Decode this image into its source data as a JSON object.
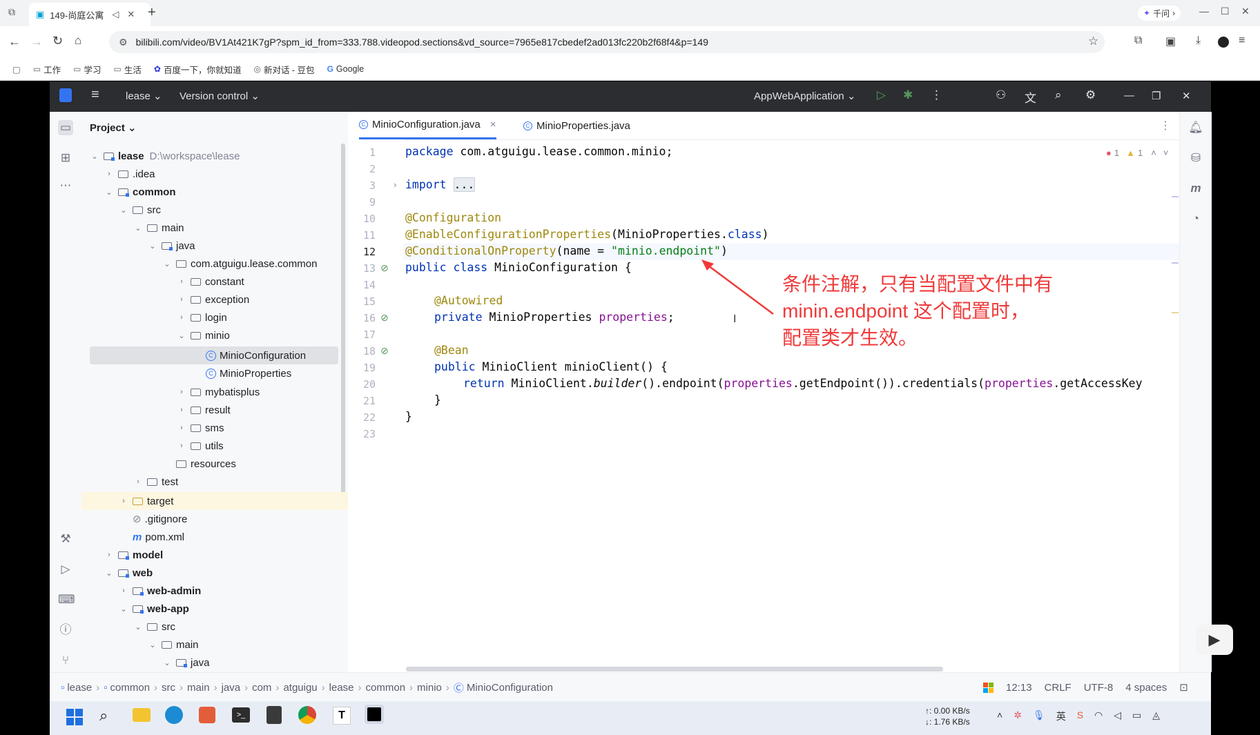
{
  "browser": {
    "tab_title": "149-尚庭公寓",
    "new_tab": "+",
    "qianwen": "千问",
    "url": "bilibili.com/video/BV1At421K7gP?spm_id_from=333.788.videopod.sections&vd_source=7965e817cbedef2ad013fc220b2f68f4&p=149",
    "bookmarks": [
      "工作",
      "学习",
      "生活",
      "百度一下，你就知道",
      "新对话 - 豆包",
      "Google"
    ]
  },
  "ide": {
    "project_name": "lease",
    "vcs": "Version control",
    "run_config": "AppWebApplication",
    "panel_title": "Project",
    "tree": [
      {
        "label": "lease",
        "extra": "D:\\workspace\\lease",
        "bold": true
      },
      {
        "label": ".idea"
      },
      {
        "label": "common",
        "bold": true
      },
      {
        "label": "src"
      },
      {
        "label": "main"
      },
      {
        "label": "java"
      },
      {
        "label": "com.atguigu.lease.common"
      },
      {
        "label": "constant"
      },
      {
        "label": "exception"
      },
      {
        "label": "login"
      },
      {
        "label": "minio"
      },
      {
        "label": "MinioConfiguration"
      },
      {
        "label": "MinioProperties"
      },
      {
        "label": "mybatisplus"
      },
      {
        "label": "result"
      },
      {
        "label": "sms"
      },
      {
        "label": "utils"
      },
      {
        "label": "resources"
      },
      {
        "label": "test"
      },
      {
        "label": "target"
      },
      {
        "label": ".gitignore"
      },
      {
        "label": "pom.xml"
      },
      {
        "label": "model",
        "bold": true
      },
      {
        "label": "web",
        "bold": true
      },
      {
        "label": "web-admin",
        "bold": true
      },
      {
        "label": "web-app",
        "bold": true
      },
      {
        "label": "src"
      },
      {
        "label": "main"
      },
      {
        "label": "java"
      }
    ],
    "tabs": [
      {
        "label": "MinioConfiguration.java",
        "close": "×"
      },
      {
        "label": "MinioProperties.java"
      }
    ],
    "line_numbers": [
      "1",
      "2",
      "3",
      "9",
      "10",
      "11",
      "12",
      "13",
      "14",
      "15",
      "16",
      "17",
      "18",
      "19",
      "20",
      "21",
      "22",
      "23"
    ],
    "code": {
      "l1_kw": "package",
      "l1_rest": " com.atguigu.lease.common.minio;",
      "l3_kw": "import",
      "l3_fold": "...",
      "l10": "@Configuration",
      "l11_ann": "@EnableConfigurationProperties",
      "l11_a": "(MinioProperties.",
      "l11_kw": "class",
      "l11_b": ")",
      "l12_ann": "@ConditionalOnProperty",
      "l12_a": "(name = ",
      "l12_str": "\"minio.endpoint\"",
      "l12_b": ")",
      "l13_kw1": "public",
      "l13_kw2": "class",
      "l13_rest": " MinioConfiguration {",
      "l15": "@Autowired",
      "l16_kw": "private",
      "l16_a": " MinioProperties ",
      "l16_fld": "properties",
      "l16_b": ";",
      "l18": "@Bean",
      "l19_kw": "public",
      "l19_rest": " MinioClient minioClient() {",
      "l20_kw": "return",
      "l20_a": " MinioClient.",
      "l20_it": "builder",
      "l20_b": "().endpoint(",
      "l20_fld1": "properties",
      "l20_c": ".getEndpoint()).credentials(",
      "l20_fld2": "properties",
      "l20_d": ".getAccessKey",
      "l21": "}",
      "l22": "}"
    },
    "inspection": {
      "errors": "1",
      "warnings": "1"
    },
    "breadcrumbs": [
      "lease",
      "common",
      "src",
      "main",
      "java",
      "com",
      "atguigu",
      "lease",
      "common",
      "minio",
      "MinioConfiguration"
    ],
    "status": {
      "position": "12:13",
      "line_sep": "CRLF",
      "encoding": "UTF-8",
      "indent": "4 spaces"
    }
  },
  "annotation": {
    "line1": "条件注解，只有当配置文件中有",
    "line2": "minin.endpoint 这个配置时，",
    "line3": "配置类才生效。"
  },
  "taskbar": {
    "net_up": "↑: 0.00 KB/s",
    "net_down": "↓: 1.76 KB/s"
  }
}
